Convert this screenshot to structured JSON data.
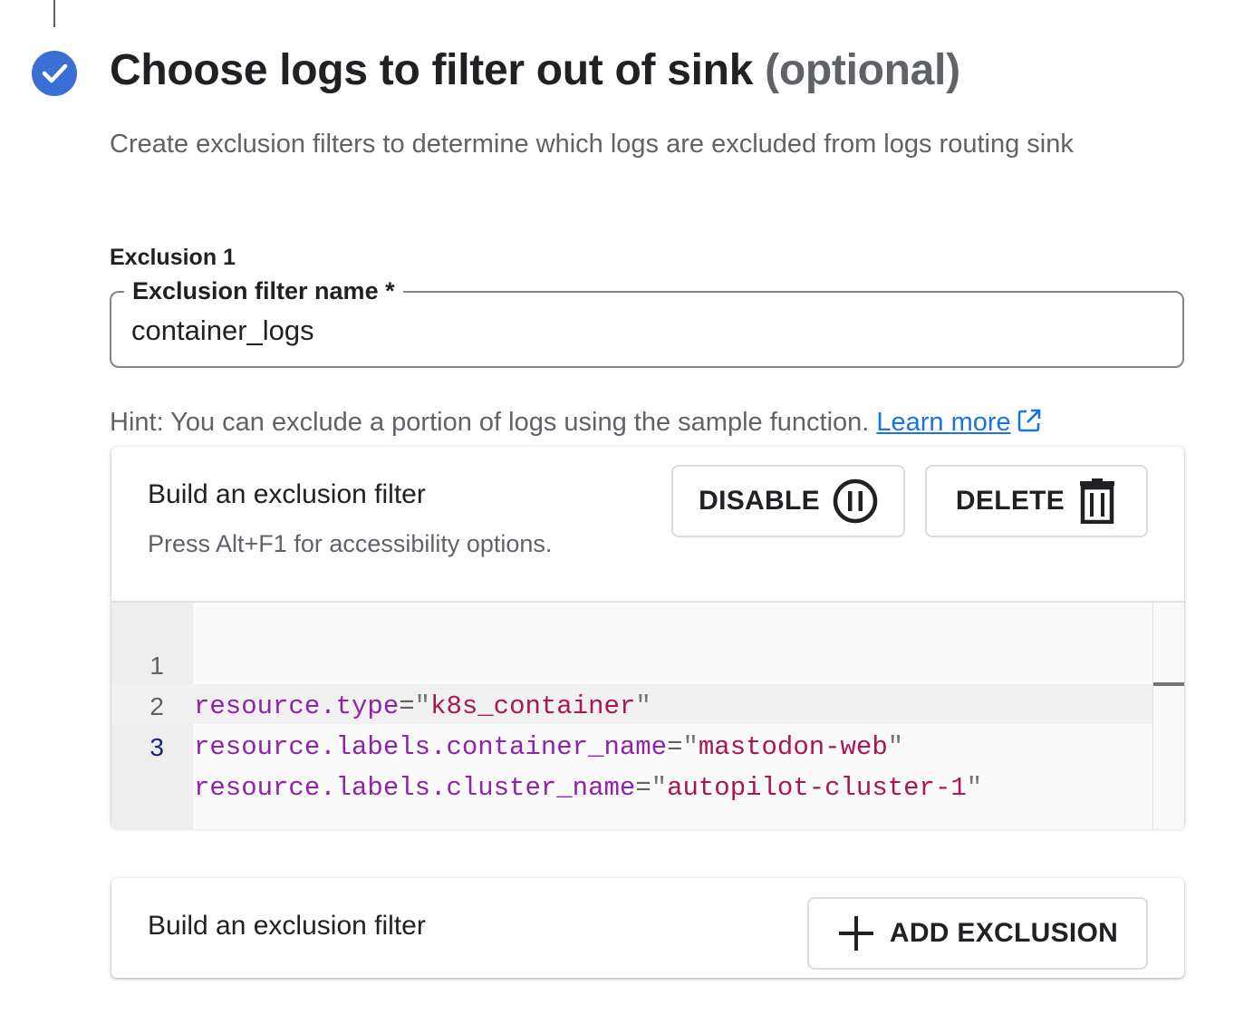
{
  "step": {
    "title": "Choose logs to filter out of sink",
    "title_optional": "(optional)",
    "description": "Create exclusion filters to determine which logs are excluded from logs routing sink",
    "icon": "check-circle-icon",
    "accent_color": "#3b6fd6"
  },
  "exclusion": {
    "heading": "Exclusion 1",
    "name_field": {
      "label": "Exclusion filter name *",
      "value": "container_logs"
    },
    "hint": {
      "text": "Hint: You can exclude a portion of logs using the sample function. ",
      "link_text": "Learn more",
      "link_icon": "open-in-new-icon"
    },
    "builder": {
      "title": "Build an exclusion filter",
      "subtitle": "Press Alt+F1 for accessibility options.",
      "disable_label": "DISABLE",
      "disable_icon": "pause-circle-icon",
      "delete_label": "DELETE",
      "delete_icon": "trash-icon",
      "editor": {
        "active_line": 3,
        "lines": [
          {
            "number": "1",
            "key": "resource.type",
            "op": "=",
            "value": "k8s_container"
          },
          {
            "number": "2",
            "key": "resource.labels.container_name",
            "op": "=",
            "value": "mastodon-web"
          },
          {
            "number": "3",
            "key": "resource.labels.cluster_name",
            "op": "=",
            "value": "autopilot-cluster-1"
          }
        ]
      }
    }
  },
  "add_section": {
    "title": "Build an exclusion filter",
    "add_label": "ADD EXCLUSION",
    "add_icon": "plus-icon"
  }
}
